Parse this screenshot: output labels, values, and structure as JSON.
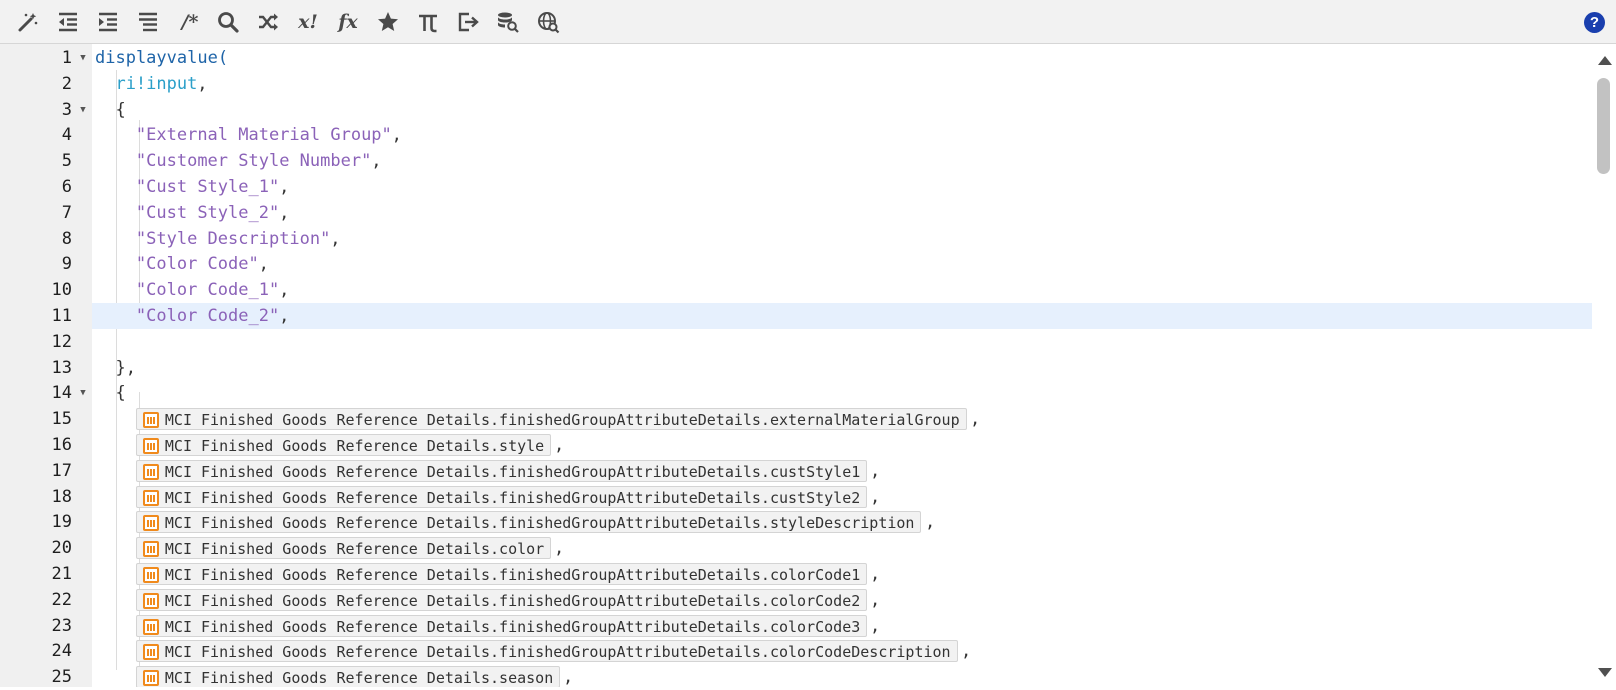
{
  "toolbar": {
    "buttons": [
      {
        "name": "magic-wand-icon"
      },
      {
        "name": "outdent-icon"
      },
      {
        "name": "indent-icon"
      },
      {
        "name": "list-icon"
      },
      {
        "name": "comment-icon",
        "label": "/*"
      },
      {
        "name": "search-icon"
      },
      {
        "name": "shuffle-icon"
      },
      {
        "name": "factorial-icon",
        "label": "x!"
      },
      {
        "name": "function-icon",
        "label": "fx"
      },
      {
        "name": "star-icon"
      },
      {
        "name": "pi-icon"
      },
      {
        "name": "export-icon"
      },
      {
        "name": "database-search-icon"
      },
      {
        "name": "globe-search-icon"
      }
    ],
    "help_label": "?"
  },
  "editor": {
    "active_line": 11,
    "lines": [
      {
        "n": "1",
        "fold": true
      },
      {
        "n": "2"
      },
      {
        "n": "3",
        "fold": true
      },
      {
        "n": "4"
      },
      {
        "n": "5"
      },
      {
        "n": "6"
      },
      {
        "n": "7"
      },
      {
        "n": "8"
      },
      {
        "n": "9"
      },
      {
        "n": "10"
      },
      {
        "n": "11"
      },
      {
        "n": "12"
      },
      {
        "n": "13"
      },
      {
        "n": "14",
        "fold": true
      },
      {
        "n": "15"
      },
      {
        "n": "16"
      },
      {
        "n": "17"
      },
      {
        "n": "18"
      },
      {
        "n": "19"
      },
      {
        "n": "20"
      },
      {
        "n": "21"
      },
      {
        "n": "22"
      },
      {
        "n": "23"
      },
      {
        "n": "24"
      },
      {
        "n": "25"
      }
    ],
    "code": {
      "fn_name": "displayvalue(",
      "input_var": "ri!input",
      "comma": ",",
      "open_brace": "{",
      "close_brace_comma": "},",
      "strings": [
        "\"External Material Group\"",
        "\"Customer Style Number\"",
        "\"Cust Style_1\"",
        "\"Cust Style_2\"",
        "\"Style Description\"",
        "\"Color Code\"",
        "\"Color Code_1\"",
        "\"Color Code_2\""
      ],
      "refs": [
        "MCI Finished Goods Reference Details.finishedGroupAttributeDetails.externalMaterialGroup",
        "MCI Finished Goods Reference Details.style",
        "MCI Finished Goods Reference Details.finishedGroupAttributeDetails.custStyle1",
        "MCI Finished Goods Reference Details.finishedGroupAttributeDetails.custStyle2",
        "MCI Finished Goods Reference Details.finishedGroupAttributeDetails.styleDescription",
        "MCI Finished Goods Reference Details.color",
        "MCI Finished Goods Reference Details.finishedGroupAttributeDetails.colorCode1",
        "MCI Finished Goods Reference Details.finishedGroupAttributeDetails.colorCode2",
        "MCI Finished Goods Reference Details.finishedGroupAttributeDetails.colorCode3",
        "MCI Finished Goods Reference Details.finishedGroupAttributeDetails.colorCodeDescription",
        "MCI Finished Goods Reference Details.season"
      ]
    }
  },
  "colors": {
    "function": "#1e64a8",
    "rule_input": "#2b9fc9",
    "string": "#8b62b8",
    "active_line": "#e6f0fd",
    "help_button": "#1a3fae",
    "record_icon": "#f08a1c"
  }
}
